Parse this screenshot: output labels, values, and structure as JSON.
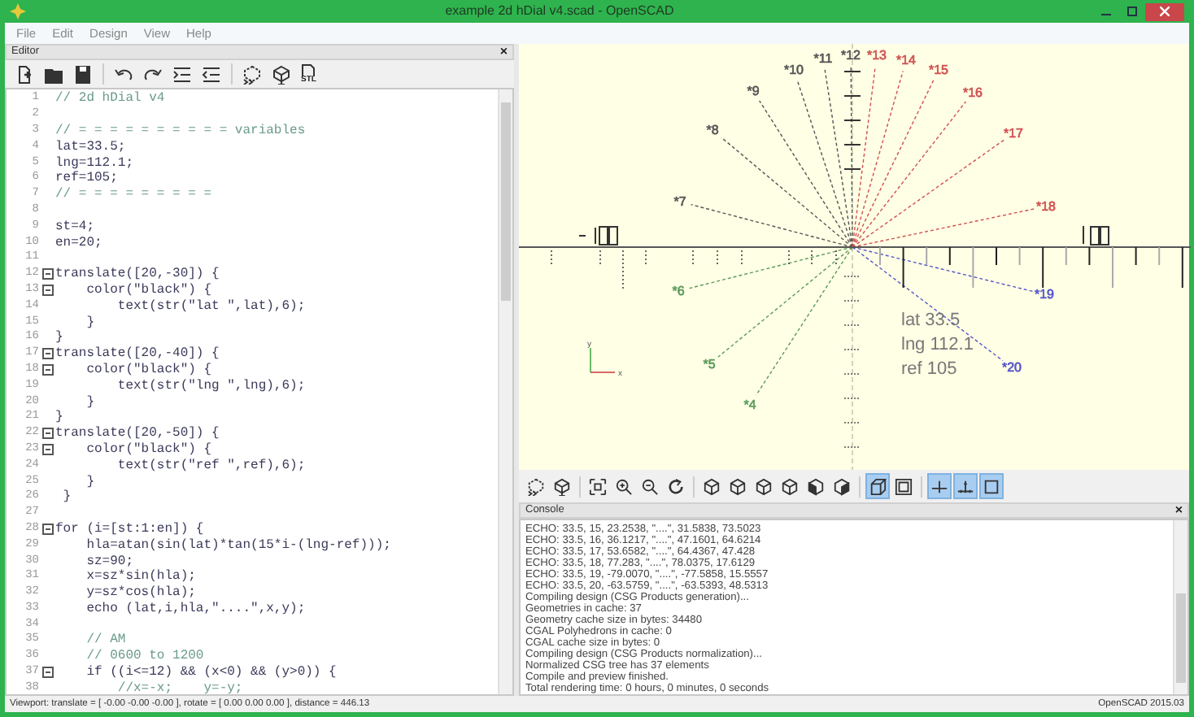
{
  "window": {
    "title": "example 2d hDial v4.scad - OpenSCAD"
  },
  "menu": [
    "File",
    "Edit",
    "Design",
    "View",
    "Help"
  ],
  "editor": {
    "title": "Editor",
    "close": "×",
    "toolbar": [
      {
        "kind": "new"
      },
      {
        "kind": "open"
      },
      {
        "kind": "save"
      },
      {
        "kind": "undo"
      },
      {
        "kind": "redo"
      },
      {
        "kind": "indent"
      },
      {
        "kind": "unindent"
      },
      {
        "kind": "preview"
      },
      {
        "kind": "render"
      },
      {
        "kind": "export_stl",
        "label": "STL"
      }
    ],
    "lines": [
      {
        "number": "1",
        "text": "// 2d hDial v4",
        "kind": "comment",
        "fold": false
      },
      {
        "number": "2",
        "fold": false
      },
      {
        "number": "3",
        "text": "// = = = = = = = = = = variables",
        "kind": "comment",
        "fold": false
      },
      {
        "number": "4",
        "text": "lat=33.5;",
        "kind": "code",
        "fold": false
      },
      {
        "number": "5",
        "text": "lng=112.1;",
        "kind": "code",
        "fold": false
      },
      {
        "number": "6",
        "text": "ref=105;",
        "kind": "code",
        "fold": false
      },
      {
        "number": "7",
        "text": "// = = = = = = = = =",
        "kind": "comment",
        "fold": false
      },
      {
        "number": "8",
        "fold": false
      },
      {
        "number": "9",
        "text": "st=4;",
        "kind": "code",
        "fold": false
      },
      {
        "number": "10",
        "text": "en=20;",
        "kind": "code",
        "fold": false
      },
      {
        "number": "11",
        "fold": false
      },
      {
        "number": "12",
        "text": "translate([20,-30]) {",
        "kind": "code",
        "fold": true
      },
      {
        "number": "13",
        "text": "    color(\"black\") {",
        "kind": "code",
        "fold": true
      },
      {
        "number": "14",
        "text": "        text(str(\"lat \",lat),6);",
        "kind": "code",
        "fold": false
      },
      {
        "number": "15",
        "text": "    }",
        "kind": "code",
        "fold": false
      },
      {
        "number": "16",
        "text": "}",
        "kind": "code",
        "fold": false
      },
      {
        "number": "17",
        "text": "translate([20,-40]) {",
        "kind": "code",
        "fold": true
      },
      {
        "number": "18",
        "text": "    color(\"black\") {",
        "kind": "code",
        "fold": true
      },
      {
        "number": "19",
        "text": "        text(str(\"lng \",lng),6);",
        "kind": "code",
        "fold": false
      },
      {
        "number": "20",
        "text": "    }",
        "kind": "code",
        "fold": false
      },
      {
        "number": "21",
        "text": "}",
        "kind": "code",
        "fold": false
      },
      {
        "number": "22",
        "text": "translate([20,-50]) {",
        "kind": "code",
        "fold": true
      },
      {
        "number": "23",
        "text": "    color(\"black\") {",
        "kind": "code",
        "fold": true
      },
      {
        "number": "24",
        "text": "        text(str(\"ref \",ref),6);",
        "kind": "code",
        "fold": false
      },
      {
        "number": "25",
        "text": "    }",
        "kind": "code",
        "fold": false
      },
      {
        "number": "26",
        "text": " }",
        "kind": "code",
        "fold": false
      },
      {
        "number": "27",
        "fold": false
      },
      {
        "number": "28",
        "text": "for (i=[st:1:en]) {",
        "kind": "code",
        "fold": true
      },
      {
        "number": "29",
        "text": "    hla=atan(sin(lat)*tan(15*i-(lng-ref)));",
        "kind": "code",
        "fold": false
      },
      {
        "number": "30",
        "text": "    sz=90;",
        "kind": "code",
        "fold": false
      },
      {
        "number": "31",
        "text": "    x=sz*sin(hla);",
        "kind": "code",
        "fold": false
      },
      {
        "number": "32",
        "text": "    y=sz*cos(hla);",
        "kind": "code",
        "fold": false
      },
      {
        "number": "33",
        "text": "    echo (lat,i,hla,\"....\",x,y);",
        "kind": "code",
        "fold": false
      },
      {
        "number": "34",
        "fold": false
      },
      {
        "number": "35",
        "text": "    // AM",
        "kind": "comment",
        "fold": false
      },
      {
        "number": "36",
        "text": "    // 0600 to 1200",
        "kind": "comment",
        "fold": false
      },
      {
        "number": "37",
        "text": "    if ((i<=12) && (x<0) && (y>0)) {",
        "kind": "code",
        "fold": true
      },
      {
        "number": "38",
        "text": "        //x=-x;    y=-y;",
        "kind": "comment",
        "fold": false
      }
    ]
  },
  "viewport": {
    "hour_labels": [
      {
        "text": "*4",
        "color": "#5a9a5a"
      },
      {
        "text": "*5",
        "color": "#5a9a5a"
      },
      {
        "text": "*6",
        "color": "#5a9a5a"
      },
      {
        "text": "*7",
        "color": "#555555"
      },
      {
        "text": "*8",
        "color": "#555555"
      },
      {
        "text": "*9",
        "color": "#555555"
      },
      {
        "text": "*10",
        "color": "#555555"
      },
      {
        "text": "*11",
        "color": "#555555"
      },
      {
        "text": "*12",
        "color": "#555555"
      },
      {
        "text": "*13",
        "color": "#d05050"
      },
      {
        "text": "*14",
        "color": "#d05050"
      },
      {
        "text": "*15",
        "color": "#d05050"
      },
      {
        "text": "*16",
        "color": "#d05050"
      },
      {
        "text": "*17",
        "color": "#d05050"
      },
      {
        "text": "*18",
        "color": "#d05050"
      },
      {
        "text": "*19",
        "color": "#5555cc"
      },
      {
        "text": "*20",
        "color": "#5555cc"
      }
    ],
    "info": [
      "lat 33.5",
      "lng 112.1",
      "ref 105"
    ],
    "axis_labels": [
      "y",
      "x"
    ]
  },
  "view_toolbar": [
    {
      "kind": "preview",
      "selected": false
    },
    {
      "kind": "render",
      "selected": false
    },
    {
      "kind": "view_all",
      "selected": false
    },
    {
      "kind": "zoom_in",
      "selected": false
    },
    {
      "kind": "zoom_out",
      "selected": false
    },
    {
      "kind": "reset",
      "selected": false
    },
    {
      "kind": "cube",
      "selected": false
    },
    {
      "kind": "cube",
      "selected": false
    },
    {
      "kind": "cube",
      "selected": false
    },
    {
      "kind": "cube",
      "selected": false
    },
    {
      "kind": "cube_front",
      "selected": false
    },
    {
      "kind": "cube_back",
      "selected": false
    },
    {
      "kind": "perspective",
      "selected": true
    },
    {
      "kind": "orthogonal",
      "selected": false
    },
    {
      "kind": "axes",
      "selected": true
    },
    {
      "kind": "scale",
      "selected": true
    },
    {
      "kind": "edges",
      "selected": true
    }
  ],
  "console": {
    "title": "Console",
    "close": "×",
    "lines": [
      "ECHO: 33.5, 15, 23.2538, \"....\", 31.5838, 73.5023",
      "ECHO: 33.5, 16, 36.1217, \"....\", 47.1601, 64.6214",
      "ECHO: 33.5, 17, 53.6582, \"....\", 64.4367, 47.428",
      "ECHO: 33.5, 18, 77.283, \"....\", 78.0375, 17.6129",
      "ECHO: 33.5, 19, -79.0070, \"....\", -77.5858, 15.5557",
      "ECHO: 33.5, 20, -63.5759, \"....\", -63.5393, 48.5313",
      "Compiling design (CSG Products generation)...",
      "Geometries in cache: 37",
      "Geometry cache size in bytes: 34480",
      "CGAL Polyhedrons in cache: 0",
      "CGAL cache size in bytes: 0",
      "Compiling design (CSG Products normalization)...",
      "Normalized CSG tree has 37 elements",
      "Compile and preview finished.",
      "Total rendering time: 0 hours, 0 minutes, 0 seconds"
    ]
  },
  "status_bar": {
    "viewport": "Viewport: translate = [ -0.00 -0.00 -0.00 ], rotate = [ 0.00 0.00 0.00 ], distance = 446.13",
    "version": "OpenSCAD 2015.03"
  }
}
